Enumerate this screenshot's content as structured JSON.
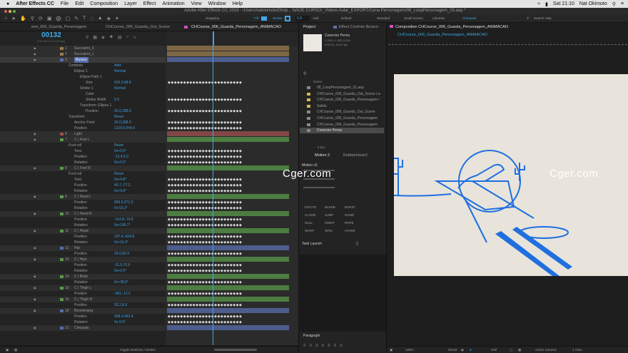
{
  "menubar": {
    "apple": "",
    "app_name": "After Effects CC",
    "items": [
      "File",
      "Edit",
      "Composition",
      "Layer",
      "Effect",
      "Animation",
      "View",
      "Window",
      "Help"
    ],
    "clock": "Sat 21:10",
    "user": "Nat Okimoto"
  },
  "window_title": "Adobe After Effects CC 2018 - /Users/natokimoto/Drop... NAOE CURSO/_Videos Aula/_EXPORT/Cena Personagem/08_LoopPersonagem_03.aep *",
  "toolbar": {
    "snapping": "Snapping",
    "fill": "Fill:",
    "stroke": "Stroke:",
    "stroke_width": "5.9",
    "add": "Add:",
    "workspaces": [
      "Default",
      "Standard",
      "Small Screen",
      "Libraries",
      "Character"
    ],
    "search_placeholder": "Search Help"
  },
  "timeline_tabs": [
    "ene_006_Guarda_Personagem",
    "CHCourse_006_Guarda_Out_Scene",
    "CHCourse_006_Guarda_Personagem_ANIMACAO"
  ],
  "timecode": "00132",
  "timecode_sub": "0:00:05:12 (24.00 fps)",
  "layer_name_header": "Layer Name",
  "layers": [
    {
      "n": "1",
      "name": "Succulent_3",
      "type": "layer",
      "color": "#9b7c4f",
      "indent": 0
    },
    {
      "n": "2",
      "name": "Succulent_1",
      "type": "layer",
      "color": "#9b7c4f",
      "indent": 0
    },
    {
      "n": "3",
      "name": "Buraco",
      "type": "layer",
      "color": "#5a6fb0",
      "indent": 0,
      "selected": true
    },
    {
      "name": "Contents",
      "type": "prop",
      "indent": 1,
      "value": "Add:"
    },
    {
      "name": "Ellipse 1",
      "type": "prop",
      "indent": 2,
      "value": "Normal"
    },
    {
      "name": "Ellipse Path 1",
      "type": "prop",
      "indent": 3
    },
    {
      "name": "Size",
      "type": "prop",
      "indent": 4,
      "value": "420.0,98.8"
    },
    {
      "name": "Stroke 1",
      "type": "prop",
      "indent": 3,
      "value": "Normal"
    },
    {
      "name": "Color",
      "type": "prop",
      "indent": 4
    },
    {
      "name": "Stroke Width",
      "type": "prop",
      "indent": 4,
      "value": "5.9"
    },
    {
      "name": "Transform: Ellipse 1",
      "type": "prop",
      "indent": 3
    },
    {
      "name": "Position",
      "type": "prop",
      "indent": 4,
      "value": "26.0,288.0"
    },
    {
      "name": "Transform",
      "type": "prop",
      "indent": 1,
      "value": "Reset"
    },
    {
      "name": "Anchor Point",
      "type": "prop",
      "indent": 2,
      "value": "26.0,288.0"
    },
    {
      "name": "Position",
      "type": "prop",
      "indent": 2,
      "value": "1216.0,944.0"
    },
    {
      "n": "6",
      "name": "Light",
      "type": "layer",
      "color": "#a05050",
      "indent": 0
    },
    {
      "n": "7",
      "name": "C | Foot L",
      "type": "layer",
      "color": "#5a9a4a",
      "indent": 0
    },
    {
      "name": "Foot roll",
      "type": "prop",
      "indent": 1,
      "value": "Reset"
    },
    {
      "name": "Toes",
      "type": "prop",
      "indent": 2,
      "value": "0x+0.0°"
    },
    {
      "name": "Position",
      "type": "prop",
      "indent": 2,
      "value": "-13.4,0.0"
    },
    {
      "name": "Rotation",
      "type": "prop",
      "indent": 2,
      "value": "0x+0.0°"
    },
    {
      "n": "8",
      "name": "C | Foot R",
      "type": "layer",
      "color": "#5a9a4a",
      "indent": 0
    },
    {
      "name": "Foot roll",
      "type": "prop",
      "indent": 1,
      "value": "Reset"
    },
    {
      "name": "Toes",
      "type": "prop",
      "indent": 2,
      "value": "0x+4.8°"
    },
    {
      "name": "Position",
      "type": "prop",
      "indent": 2,
      "value": "40.7,-77.2"
    },
    {
      "name": "Rotation",
      "type": "prop",
      "indent": 2,
      "value": "0x+9.8°"
    },
    {
      "n": "9",
      "name": "C | Hand L",
      "type": "layer",
      "color": "#5a9a4a",
      "indent": 0
    },
    {
      "name": "Position",
      "type": "prop",
      "indent": 2,
      "value": "969.5,371.0"
    },
    {
      "name": "Rotation",
      "type": "prop",
      "indent": 2,
      "value": "0x-53.3°"
    },
    {
      "n": "10",
      "name": "C | Hand R",
      "type": "layer",
      "color": "#5a9a4a",
      "indent": 0
    },
    {
      "name": "Position",
      "type": "prop",
      "indent": 2,
      "value": "-114.8,-74.8"
    },
    {
      "name": "Rotation",
      "type": "prop",
      "indent": 2,
      "value": "0x+196.7°"
    },
    {
      "n": "11",
      "name": "C | Head",
      "type": "layer",
      "color": "#5a9a4a",
      "indent": 0
    },
    {
      "name": "Position",
      "type": "prop",
      "indent": 2,
      "value": "197.4,-604.8"
    },
    {
      "name": "Rotation",
      "type": "prop",
      "indent": 2,
      "value": "0x+16.3°"
    },
    {
      "n": "12",
      "name": "Hat",
      "type": "layer",
      "color": "#5a6fb0",
      "indent": 0
    },
    {
      "name": "Position",
      "type": "prop",
      "indent": 2,
      "value": "29.0,82.9"
    },
    {
      "n": "13",
      "name": "C | Hips",
      "type": "layer",
      "color": "#5a9a4a",
      "indent": 0
    },
    {
      "name": "Position",
      "type": "prop",
      "indent": 2,
      "value": "-11.9,76.9"
    },
    {
      "name": "Rotation",
      "type": "prop",
      "indent": 2,
      "value": "0x+0.0°"
    },
    {
      "n": "14",
      "name": "C | Body",
      "type": "layer",
      "color": "#5a9a4a",
      "indent": 0
    },
    {
      "name": "Rotation",
      "type": "prop",
      "indent": 2,
      "value": "0x+38.8°"
    },
    {
      "n": "15",
      "name": "C | Thigh L",
      "type": "layer",
      "color": "#5a9a4a",
      "indent": 0
    },
    {
      "name": "Position",
      "type": "prop",
      "indent": 2,
      "value": "-461.-12.2"
    },
    {
      "n": "16",
      "name": "C | Thigh R",
      "type": "layer",
      "color": "#5a9a4a",
      "indent": 0
    },
    {
      "name": "Position",
      "type": "prop",
      "indent": 2,
      "value": "55.2,8.9"
    },
    {
      "n": "18",
      "name": "Boomerang",
      "type": "layer",
      "color": "#5a6fb0",
      "indent": 0
    },
    {
      "name": "Position",
      "type": "prop",
      "indent": 2,
      "value": "308.4,482.4"
    },
    {
      "name": "Rotation",
      "type": "prop",
      "indent": 2,
      "value": "0x-0.0°"
    },
    {
      "n": "21",
      "name": "Chegada",
      "type": "layer",
      "color": "#5a6fb0",
      "indent": 0
    }
  ],
  "structure_label": "Structure",
  "bottom_bar": {
    "toggle": "Toggle Switches / Modes"
  },
  "project_panel": {
    "tab": "Project",
    "tab2": "Effect Controls Buraco",
    "preview_name": "Conector Perna",
    "preview_info1": "1,200 x 1,200 (1.00)",
    "preview_info2": "0:00:41, 24.00 fps",
    "name_col": "Name",
    "items": [
      {
        "name": "08_LoopPersonagem_01.aep",
        "kind": "file"
      },
      {
        "name": "CHCourse_006_Guarda_Out_Scene La",
        "kind": "folder"
      },
      {
        "name": "CHCourse_006_Guarda_Personagem l",
        "kind": "folder"
      },
      {
        "name": "Solids",
        "kind": "folder"
      },
      {
        "name": "CHCourse_006_Guarda_Out_Scene",
        "kind": "comp"
      },
      {
        "name": "CHCourse_006_Guarda_Personagem",
        "kind": "comp"
      },
      {
        "name": "CHCourse_006_Guarda_Personagem",
        "kind": "comp"
      },
      {
        "name": "Conector Perna",
        "kind": "comp",
        "selected": true
      }
    ],
    "bpc": "8 bpc"
  },
  "motion_panel": {
    "tab1": "Motion 2",
    "tab2": "RubberHose2",
    "preset": "Motion v2",
    "buttons": [
      "EXCITE",
      "BLEND",
      "BURST",
      "CLONE",
      "JUMP",
      "NAME",
      "NULL",
      "ORBIT",
      "ROPE",
      "WARP",
      "SPIN",
      "STARE"
    ],
    "task": "Task Launch"
  },
  "paragraph_panel": {
    "title": "Paragraph"
  },
  "comp_panel": {
    "tab": "Composition CHCourse_006_Guarda_Personagem_ANIMACAO",
    "breadcrumb": "CHCourse_006_Guarda_Personagem_ANIMACAO",
    "zoom": "100%",
    "timecode": "00132",
    "resolution": "Half",
    "camera": "Active Camera",
    "views": "1 View"
  },
  "watermark": "Cger.com",
  "colors": {
    "accent": "#3fa7e6",
    "canvas": "#e8e4db",
    "line_art": "#1f6fe0"
  }
}
